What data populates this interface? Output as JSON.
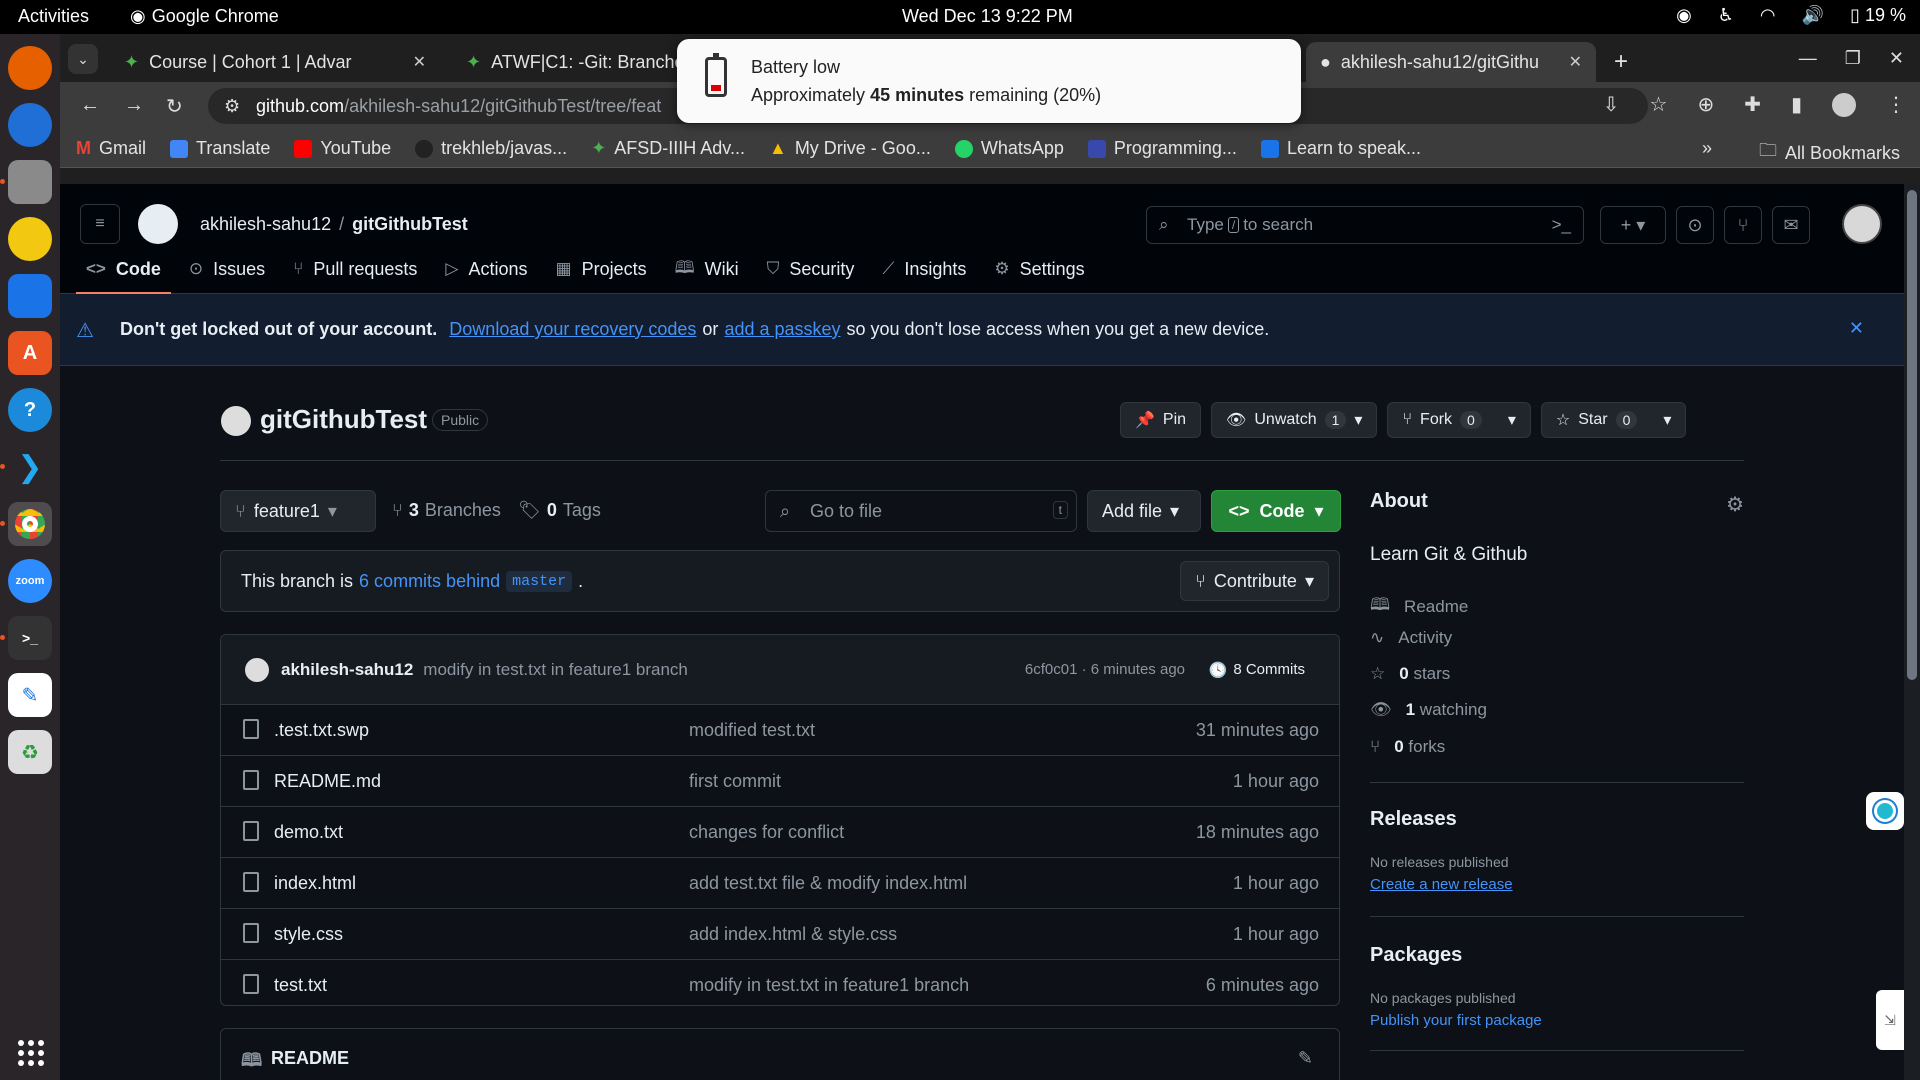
{
  "os": {
    "activities": "Activities",
    "app_name": "Google Chrome",
    "clock": "Wed Dec 13  9:22 PM",
    "battery": "19 %"
  },
  "browser": {
    "tabs": [
      {
        "title": "Course | Cohort 1 | Advar"
      },
      {
        "title": "ATWF|C1: -Git: Branches"
      },
      {
        "title": "akhilesh-sahu12/gitGithu"
      }
    ],
    "new_tab": "+",
    "url_host": "github.com",
    "url_path": "/akhilesh-sahu12/gitGithubTest/tree/feat",
    "bookmarks": [
      "Gmail",
      "Translate",
      "YouTube",
      "trekhleb/javas...",
      "AFSD-IIIH Adv...",
      "My Drive - Goo...",
      "WhatsApp",
      "Programming...",
      "Learn to speak..."
    ],
    "bookmarks_more": "»",
    "all_bookmarks": "All Bookmarks"
  },
  "notification": {
    "title": "Battery low",
    "body_pre": "Approximately ",
    "body_bold": "45 minutes",
    "body_post": " remaining (20%)"
  },
  "github": {
    "owner": "akhilesh-sahu12",
    "repo": "gitGithubTest",
    "search_pre": "Type",
    "search_key": "/",
    "search_post": "to search",
    "nav": [
      "Code",
      "Issues",
      "Pull requests",
      "Actions",
      "Projects",
      "Wiki",
      "Security",
      "Insights",
      "Settings"
    ],
    "banner": {
      "bold": "Don't get locked out of your account.",
      "link1": "Download your recovery codes",
      "mid": "or",
      "link2": "add a passkey",
      "tail": "so you don't lose access when you get a new device."
    },
    "visibility": "Public",
    "actions": {
      "pin": "Pin",
      "unwatch": "Unwatch",
      "watch_count": "1",
      "fork": "Fork",
      "fork_count": "0",
      "star": "Star",
      "star_count": "0"
    },
    "branch": "feature1",
    "branches_count": "3",
    "branches_label": "Branches",
    "tags_count": "0",
    "tags_label": "Tags",
    "go_to_file": "Go to file",
    "go_key": "t",
    "add_file": "Add file",
    "code_btn": "Code",
    "behind": {
      "pre": "This branch is",
      "link": "6 commits behind",
      "base": "master",
      "post": "."
    },
    "contribute": "Contribute",
    "latest_commit": {
      "author": "akhilesh-sahu12",
      "message": "modify in test.txt in feature1 branch",
      "hash_time": "6cf0c01 · 6 minutes ago",
      "commits": "8 Commits"
    },
    "files": [
      {
        "name": ".test.txt.swp",
        "message": "modified test.txt",
        "time": "31 minutes ago"
      },
      {
        "name": "README.md",
        "message": "first commit",
        "time": "1 hour ago"
      },
      {
        "name": "demo.txt",
        "message": "changes for conflict",
        "time": "18 minutes ago"
      },
      {
        "name": "index.html",
        "message": "add test.txt file & modify index.html",
        "time": "1 hour ago"
      },
      {
        "name": "style.css",
        "message": "add index.html & style.css",
        "time": "1 hour ago"
      },
      {
        "name": "test.txt",
        "message": "modify in test.txt in feature1 branch",
        "time": "6 minutes ago"
      }
    ],
    "readme_label": "README",
    "about": {
      "heading": "About",
      "description": "Learn Git & Github",
      "readme": "Readme",
      "activity": "Activity",
      "stars_num": "0",
      "stars": "stars",
      "watching_num": "1",
      "watching": "watching",
      "forks_num": "0",
      "forks": "forks"
    },
    "releases": {
      "heading": "Releases",
      "none": "No releases published",
      "link": "Create a new release"
    },
    "packages": {
      "heading": "Packages",
      "none": "No packages published",
      "link": "Publish your first package"
    }
  }
}
